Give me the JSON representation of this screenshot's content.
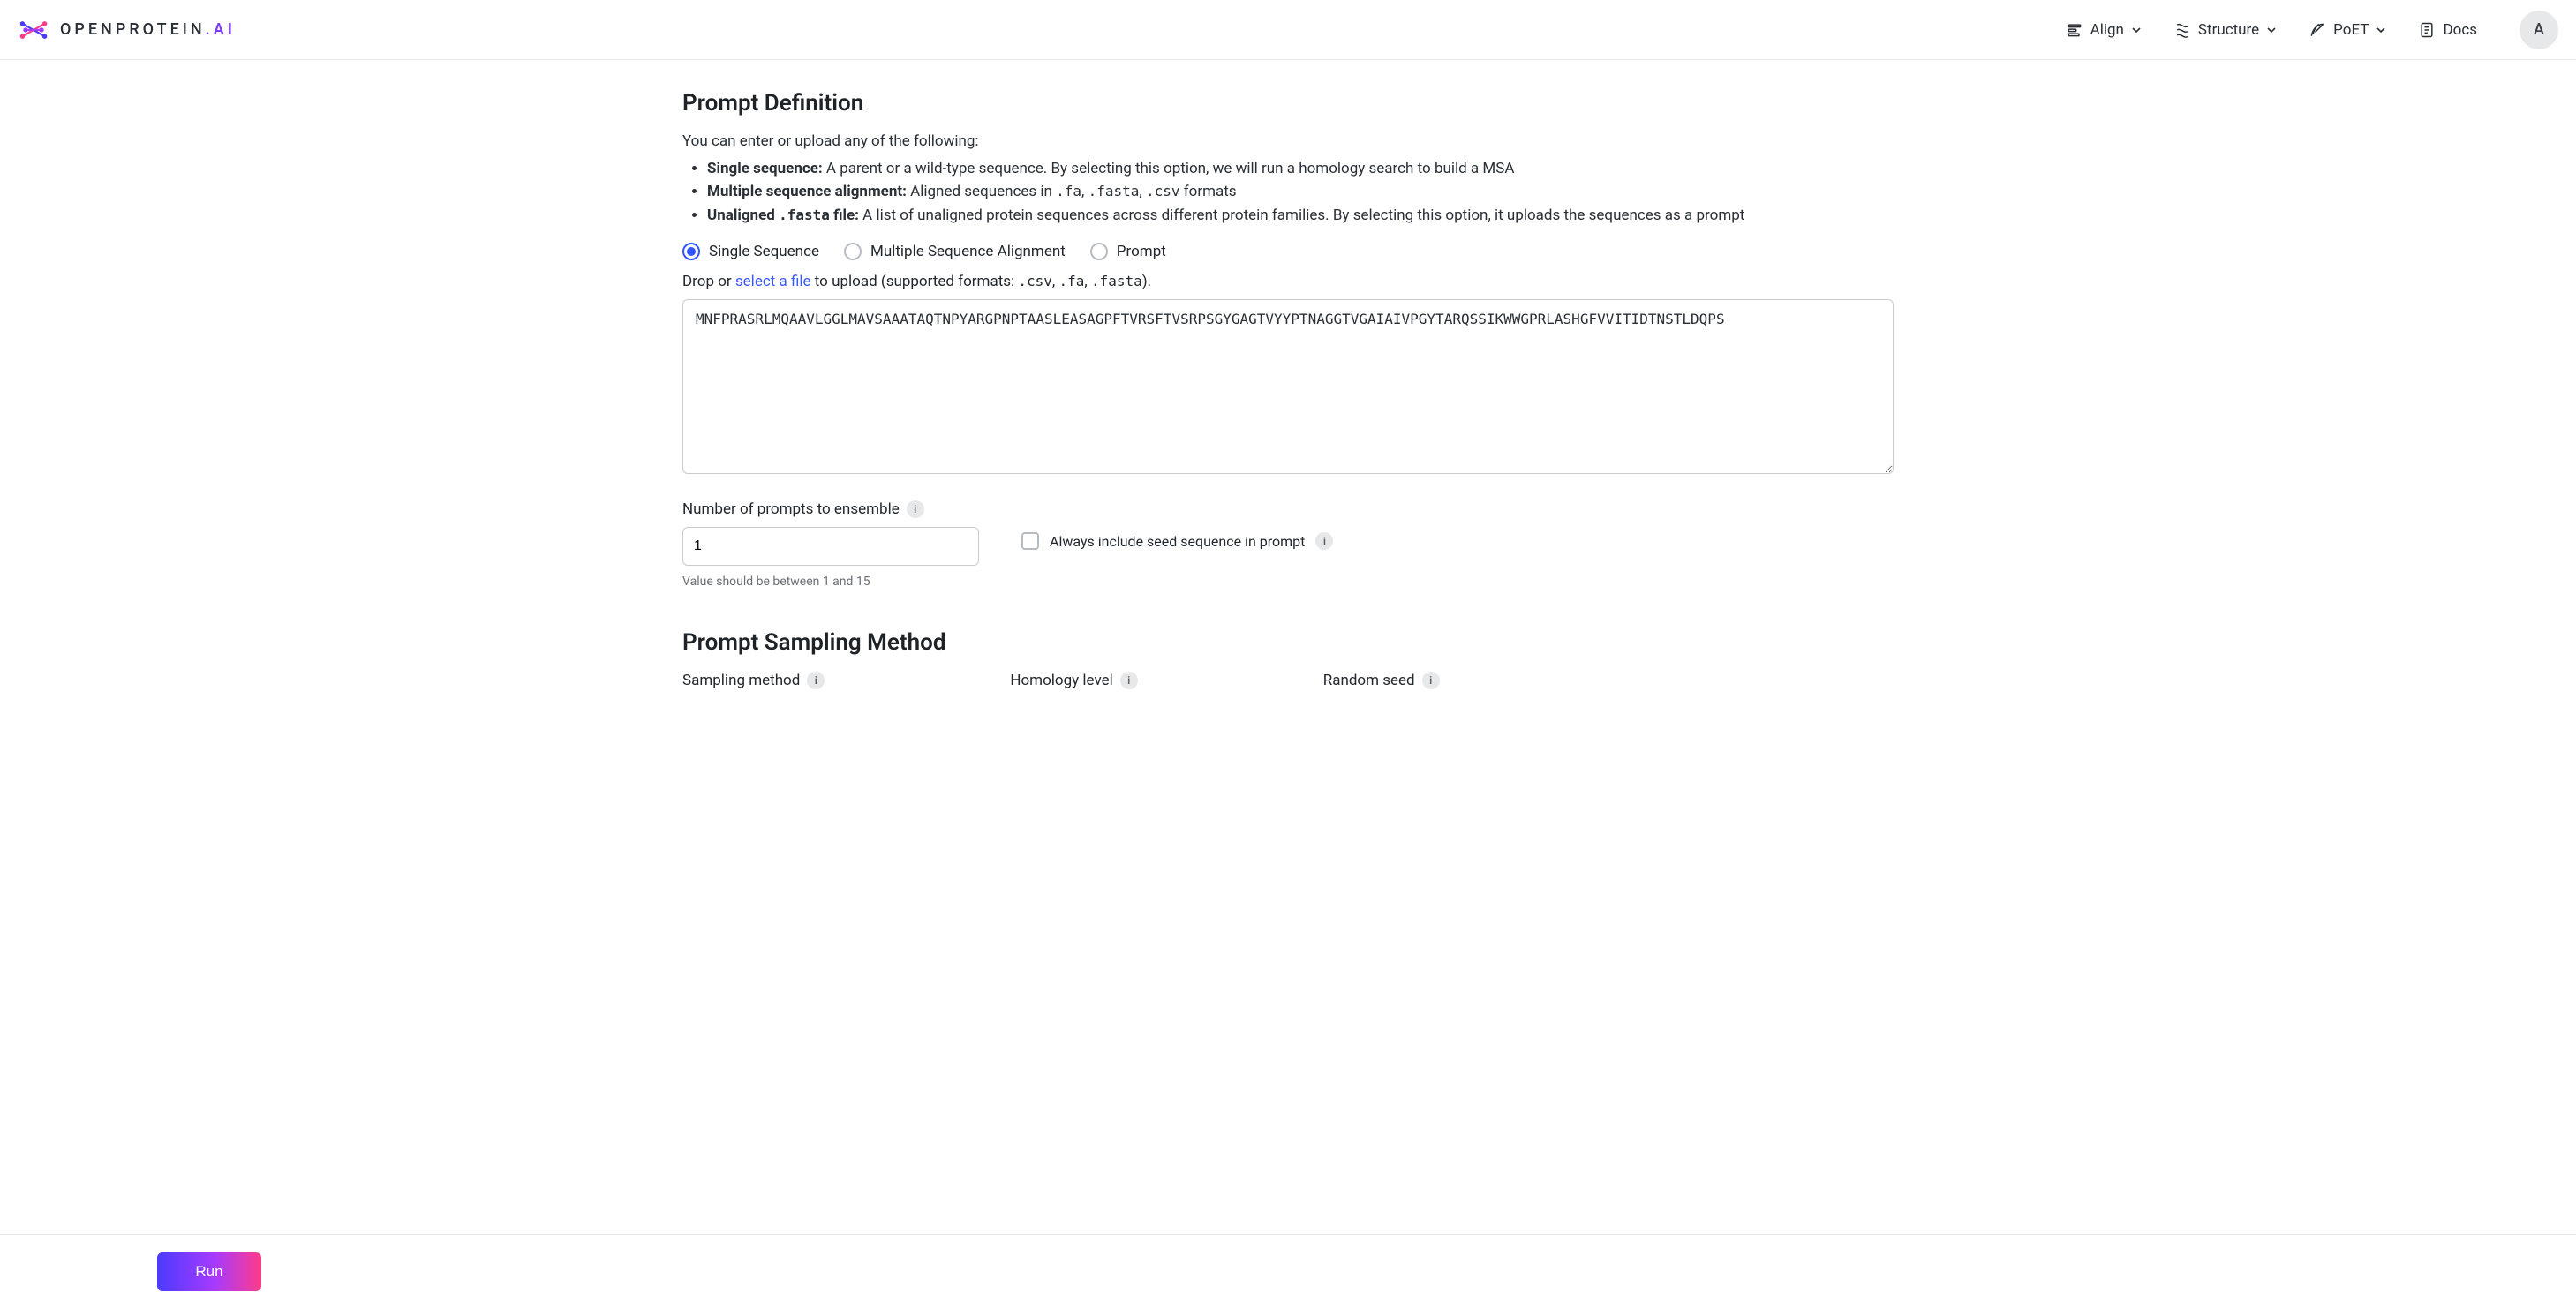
{
  "brand": {
    "word_prefix": "OPENPROTEIN",
    "word_suffix": ".AI"
  },
  "nav": {
    "align": "Align",
    "structure": "Structure",
    "poet": "PoET",
    "docs": "Docs",
    "avatar_initial": "A"
  },
  "section": {
    "prompt_definition": {
      "title": "Prompt Definition",
      "intro": "You can enter or upload any of the following:",
      "bullets": {
        "single_sequence": {
          "bold": "Single sequence:",
          "rest": " A parent or a wild-type sequence. By selecting this option, we will run a homology search to build a MSA"
        },
        "msa": {
          "bold": "Multiple sequence alignment:",
          "rest_pre": " Aligned sequences in ",
          "code1": ".fa",
          "comma1": ", ",
          "code2": ".fasta",
          "comma2": ", ",
          "code3": ".csv",
          "rest_post": " formats"
        },
        "unaligned": {
          "bold_pre": "Unaligned ",
          "bold_code": ".fasta",
          "bold_post": " file:",
          "rest": " A list of unaligned protein sequences across different protein families. By selecting this option, it uploads the sequences as a prompt"
        }
      },
      "radios": {
        "single": "Single Sequence",
        "msa": "Multiple Sequence Alignment",
        "prompt": "Prompt"
      },
      "drop_line": {
        "pre": "Drop or ",
        "link": "select a file",
        "mid": " to upload (supported formats: ",
        "code1": ".csv",
        "comma1": ", ",
        "code2": ".fa",
        "comma2": ", ",
        "code3": ".fasta",
        "post": ")."
      },
      "sequence_value": "MNFPRASRLMQAAVLGGLMAVSAAATAQTNPYARGPNPTAASLEASAGPFTVRSFTVSRPSGYGAGTVYYPTNAGGTVGAIAIVPGYTARQSSIKWWGPRLASHGFVVITIDTNSTLDQPS",
      "num_prompts": {
        "label": "Number of prompts to ensemble",
        "value": "1",
        "helper": "Value should be between 1 and 15"
      },
      "include_seed": {
        "label": "Always include seed sequence in prompt"
      }
    },
    "sampling": {
      "title": "Prompt Sampling Method",
      "sampling_method_label": "Sampling method",
      "homology_level_label": "Homology level",
      "random_seed_label": "Random seed"
    }
  },
  "footer": {
    "run": "Run"
  },
  "info_glyph": "i"
}
